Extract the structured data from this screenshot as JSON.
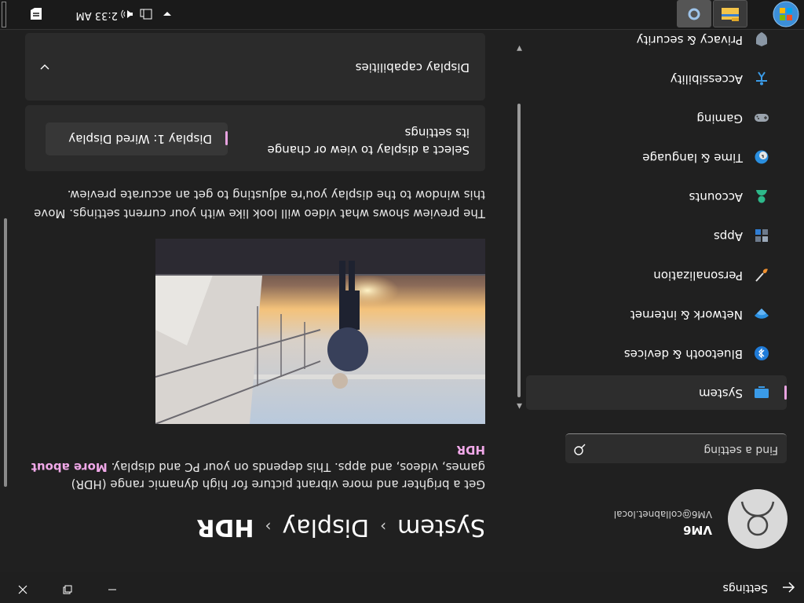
{
  "window": {
    "title": "Settings",
    "back_icon": "arrow-left-icon",
    "controls": [
      "minimize",
      "maximize",
      "close"
    ]
  },
  "user": {
    "name": "VM6",
    "email": "VM6@collabnet.local"
  },
  "search": {
    "placeholder": "Find a setting"
  },
  "sidebar": {
    "items": [
      {
        "label": "Privacy & security",
        "icon": "shield-icon"
      },
      {
        "label": "Accessibility",
        "icon": "person-accessibility-icon"
      },
      {
        "label": "Gaming",
        "icon": "gamepad-icon"
      },
      {
        "label": "Time & language",
        "icon": "globe-clock-icon"
      },
      {
        "label": "Accounts",
        "icon": "person-icon"
      },
      {
        "label": "Apps",
        "icon": "apps-icon"
      },
      {
        "label": "Personalization",
        "icon": "brush-icon"
      },
      {
        "label": "Network & internet",
        "icon": "wifi-icon"
      },
      {
        "label": "Bluetooth & devices",
        "icon": "bluetooth-icon"
      },
      {
        "label": "System",
        "icon": "monitor-icon",
        "selected": true
      }
    ]
  },
  "breadcrumb": {
    "items": [
      "System",
      "Display",
      "HDR"
    ],
    "separator": "›"
  },
  "hdr": {
    "description": "Get a brighter and more vibrant picture for high dynamic range (HDR) games, videos, and apps. This depends on your PC and display.",
    "link": "More about HDR",
    "preview_caption": "The preview shows what video will look like with your current settings. Move this window to the display you're adjusting to get an accurate preview.",
    "select_label": "Select a display to view or change its settings",
    "selected_display": "Display 1: Wired Display",
    "capabilities_label": "Display capabilities"
  },
  "taskbar": {
    "clock": "2:33 AM"
  },
  "colors": {
    "accent": "#e8a3e0",
    "background": "#202020",
    "card": "#2b2b2b"
  }
}
